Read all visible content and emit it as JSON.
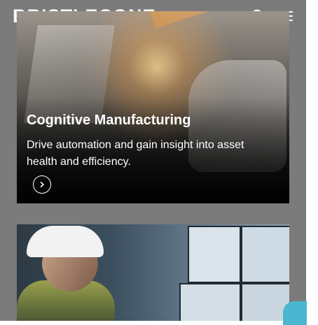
{
  "header": {
    "logo_text": "BRISTLECONE",
    "search_icon": "search-icon",
    "menu_icon": "hamburger-menu-icon"
  },
  "cards": [
    {
      "title": "Cognitive Manufacturing",
      "description": "Drive automation and gain insight into asset health and efficiency.",
      "link_icon": "chevron-right-icon"
    },
    {
      "image": "engineer-at-monitors"
    }
  ],
  "colors": {
    "page_background": "#7b7b7b",
    "text": "#ffffff",
    "chat_accent": "#4bb6cf"
  }
}
